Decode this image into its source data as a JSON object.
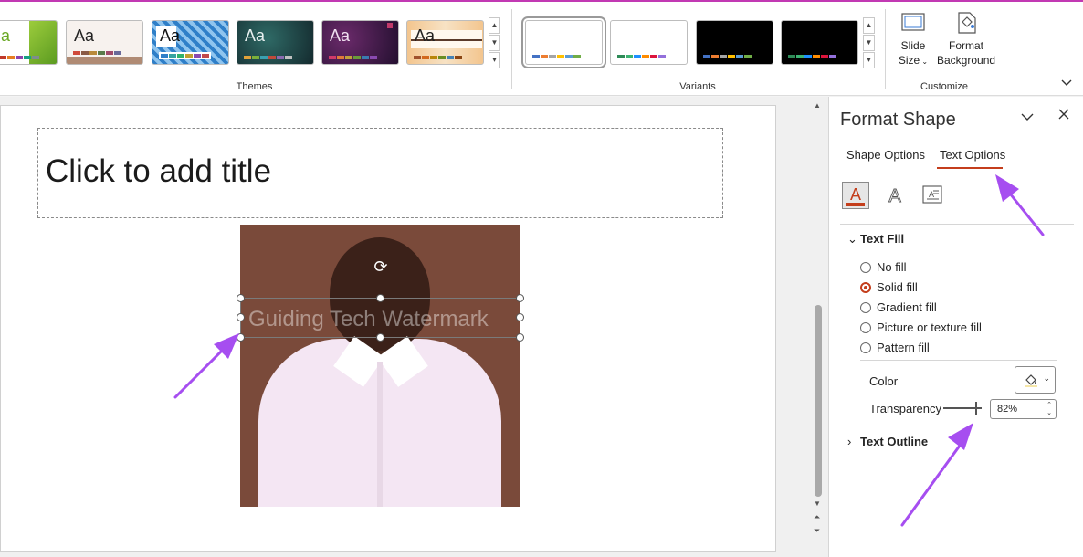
{
  "ribbon": {
    "themes_label": "Themes",
    "variants_label": "Variants",
    "customize_label": "Customize",
    "theme_thumb_text": "Aa",
    "slide_size_label_line1": "Slide",
    "slide_size_label_line2": "Size",
    "format_bg_label_line1": "Format",
    "format_bg_label_line2": "Background",
    "theme_letter_partial": "a"
  },
  "slide": {
    "title_placeholder": "Click to add title",
    "watermark_text": "Guiding Tech Watermark"
  },
  "pane": {
    "title": "Format Shape",
    "tabs": [
      {
        "label": "Shape Options"
      },
      {
        "label": "Text Options"
      }
    ],
    "active_tab": "Text Options",
    "text_fill_header": "Text Fill",
    "fill_options": [
      {
        "label": "No fill",
        "checked": false
      },
      {
        "label": "Solid fill",
        "checked": true
      },
      {
        "label": "Gradient fill",
        "checked": false
      },
      {
        "label": "Picture or texture fill",
        "checked": false
      },
      {
        "label": "Pattern fill",
        "checked": false
      }
    ],
    "color_label": "Color",
    "transparency_label": "Transparency",
    "transparency_value": "82%",
    "transparency_fraction": 0.82,
    "text_outline_header": "Text Outline"
  },
  "colors": {
    "accent": "#c43e1c",
    "annotation_arrow": "#a64ef0",
    "top_border": "#c239b3"
  },
  "icons": [
    "rotate-icon",
    "chevron-down-icon",
    "close-icon",
    "text-fill-outline-icon",
    "text-effects-icon",
    "textbox-icon",
    "paint-bucket-icon",
    "slide-size-icon",
    "format-background-icon"
  ]
}
